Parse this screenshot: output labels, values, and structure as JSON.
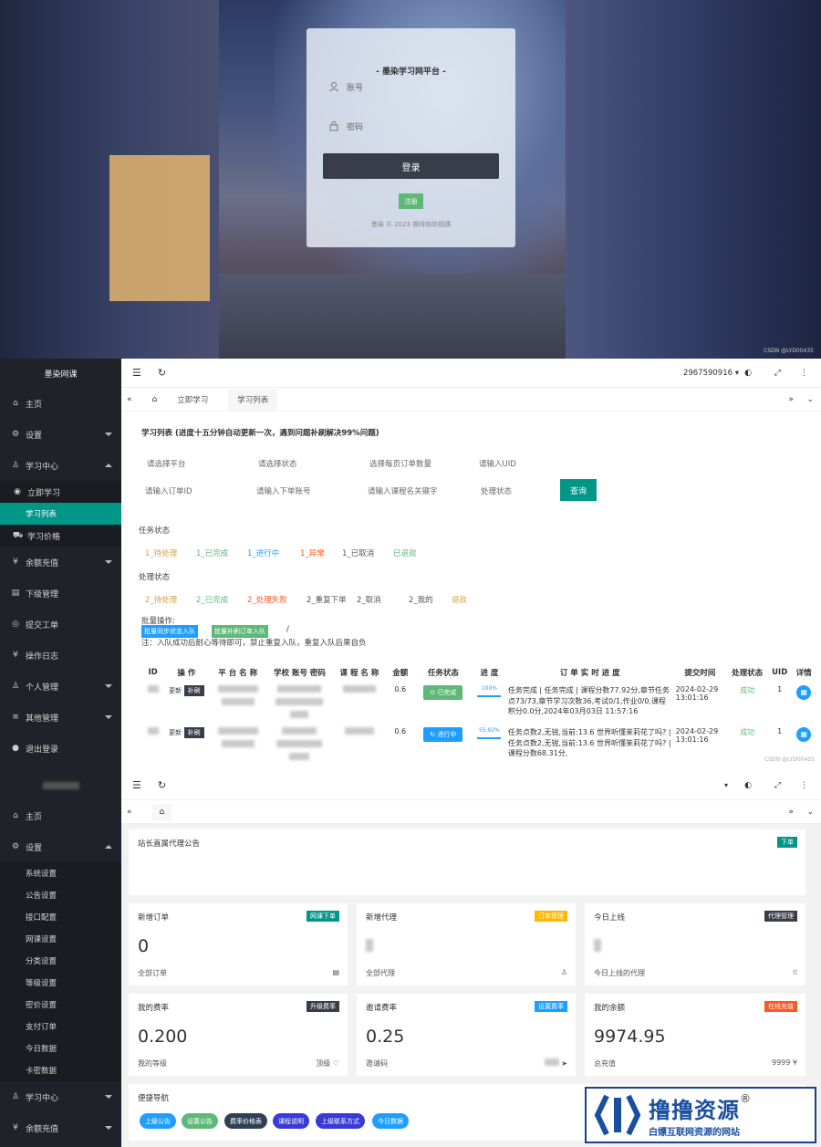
{
  "login": {
    "title": "- 墨染学习网平台 -",
    "account_placeholder": "账号",
    "password_placeholder": "密码",
    "login_btn": "登录",
    "register_btn": "注册",
    "footer": "墨染 © 2023 期待和你相遇",
    "watermark": "CSDN @LYD00435"
  },
  "sidebar1": {
    "logo": "墨染网课",
    "items": [
      {
        "label": "主页",
        "icon": "home-icon"
      },
      {
        "label": "设置",
        "icon": "gear-icon"
      },
      {
        "label": "学习中心",
        "icon": "user-icon"
      },
      {
        "label": "立即学习",
        "icon": "circle-icon"
      },
      {
        "label": "学习列表"
      },
      {
        "label": "学习价格",
        "icon": "cart-icon"
      },
      {
        "label": "余额充值",
        "icon": "yen-icon"
      },
      {
        "label": "下级管理",
        "icon": "doc-icon"
      },
      {
        "label": "提交工单",
        "icon": "ticket-icon"
      },
      {
        "label": "操作日志",
        "icon": "yen-icon"
      },
      {
        "label": "个人管理",
        "icon": "user-icon"
      },
      {
        "label": "其他管理",
        "icon": "list-icon"
      },
      {
        "label": "退出登录",
        "icon": "dot-icon"
      }
    ]
  },
  "header1": {
    "user": "2967590916",
    "tab_learn": "立即学习",
    "tab_list": "学习列表"
  },
  "list": {
    "title": "学习列表 (进度十五分钟自动更新一次，遇到问题补刷解决99%问题)",
    "filters_row1": [
      "请选择平台",
      "请选择状态",
      "选择每页订单数量",
      "请输入UID"
    ],
    "filters_row2": [
      "请输入订单ID",
      "请输入下单账号",
      "请输入课程名关键字",
      "处理状态"
    ],
    "query_btn": "查询",
    "task_status_label": "任务状态",
    "task_status": [
      {
        "text": "1_待处理",
        "color": "#d4a04c"
      },
      {
        "text": "1_已完成",
        "color": "#5fb878"
      },
      {
        "text": "1_进行中",
        "color": "#1e9fff"
      },
      {
        "text": "1_异常",
        "color": "#ff5722"
      },
      {
        "text": "1_已取消",
        "color": "#555555"
      },
      {
        "text": "已退款",
        "color": "#5fb878"
      }
    ],
    "process_status_label": "处理状态",
    "process_status": [
      {
        "text": "2_待处理",
        "color": "#d4a04c"
      },
      {
        "text": "2_已完成",
        "color": "#5fb878"
      },
      {
        "text": "2_处理失败",
        "color": "#ff5722"
      },
      {
        "text": "2_重复下单",
        "color": "#555555"
      },
      {
        "text": "2_取消",
        "color": "#555555"
      },
      {
        "text": "2_我的",
        "color": "#555555"
      },
      {
        "text": "退款",
        "color": "#d4a04c"
      }
    ],
    "bulk_label": "批量操作:",
    "bulk_btn1": "批量同步状态入队",
    "bulk_btn2": "批量补刷订单入队",
    "bulk_slash": "/",
    "note": "注：入队成功后耐心等待即可，禁止重复入队，重复入队后果自负",
    "columns": [
      "ID",
      "操 作",
      "平 台 名 称",
      "学校 账号 密码",
      "课 程 名 称",
      "金额",
      "任务状态",
      "进 度",
      "订 单 实 时 进 度",
      "提交时间",
      "处理状态",
      "UID",
      "详情"
    ],
    "rows": [
      {
        "op1": "更新",
        "op2": "补刷",
        "amount": "0.6",
        "status": "已完成",
        "status_color": "#5fb878",
        "progress": "100%",
        "detail": "任务完成 | 任务完成 | 课程分数77.92分,章节任务点73/73,章节学习次数36,考试0/1,作业0/0,课程积分0.0分,2024年03月03日 11:57:16",
        "time": "2024-02-29 13:01:16",
        "proc": "成功",
        "uid": "1"
      },
      {
        "op1": "更新",
        "op2": "补刷",
        "amount": "0.6",
        "status": "进行中",
        "status_color": "#1e9fff",
        "progress": "55.92%",
        "detail": "任务点数2,无锐,当前:13.6 世界听懂茉莉花了吗? | 任务点数2,无锐,当前:13.6 世界听懂茉莉花了吗? | 课程分数68.31分,",
        "time": "2024-02-29 13:01:16",
        "proc": "成功",
        "uid": "1"
      }
    ]
  },
  "sidebar2": {
    "items": [
      {
        "label": "主页"
      },
      {
        "label": "设置"
      },
      {
        "label": "系统设置"
      },
      {
        "label": "公告设置"
      },
      {
        "label": "接口配置"
      },
      {
        "label": "网课设置"
      },
      {
        "label": "分类设置"
      },
      {
        "label": "等级设置"
      },
      {
        "label": "密价设置"
      },
      {
        "label": "支付订单"
      },
      {
        "label": "今日数据"
      },
      {
        "label": "卡密数据"
      },
      {
        "label": "学习中心"
      },
      {
        "label": "余额充值"
      }
    ]
  },
  "dashboard": {
    "notice_title": "站长直属代理公告",
    "notice_badge": "下单",
    "cards": [
      {
        "title": "新增订单",
        "badge": "网课下单",
        "badge_color": "#009688",
        "value": "0",
        "left": "全部订单",
        "right": ""
      },
      {
        "title": "新增代理",
        "badge": "订单管理",
        "badge_color": "#ffb800",
        "value": "",
        "left": "全部代理",
        "right": ""
      },
      {
        "title": "今日上线",
        "badge": "代理管理",
        "badge_color": "#393d49",
        "value": "",
        "left": "今日上线的代理",
        "right": ""
      },
      {
        "title": "我的费率",
        "badge": "升级费率",
        "badge_color": "#393d49",
        "value": "0.200",
        "left": "我的等级",
        "right": "顶级 ♡"
      },
      {
        "title": "邀请费率",
        "badge": "设置费率",
        "badge_color": "#1e9fff",
        "value": "0.25",
        "left": "邀请码",
        "right": ""
      },
      {
        "title": "我的余额",
        "badge": "在线充值",
        "badge_color": "#ff5722",
        "value": "9974.95",
        "left": "总充值",
        "right": "9999 ¥"
      }
    ],
    "nav_title": "便捷导航",
    "nav_buttons": [
      {
        "label": "上级公告",
        "color": "#1e9fff"
      },
      {
        "label": "设置公告",
        "color": "#5fb878"
      },
      {
        "label": "费率价格表",
        "color": "#2f4056"
      },
      {
        "label": "课程说明",
        "color": "#3a3ad6"
      },
      {
        "label": "上级联系方式",
        "color": "#3a3ad6"
      },
      {
        "label": "今日数据",
        "color": "#1e9fff"
      }
    ]
  },
  "brand": {
    "name": "撸撸资源",
    "reg": "®",
    "slogan": "白嫖互联网资源的网站"
  },
  "csdn2": "CSDN @LYD00435"
}
